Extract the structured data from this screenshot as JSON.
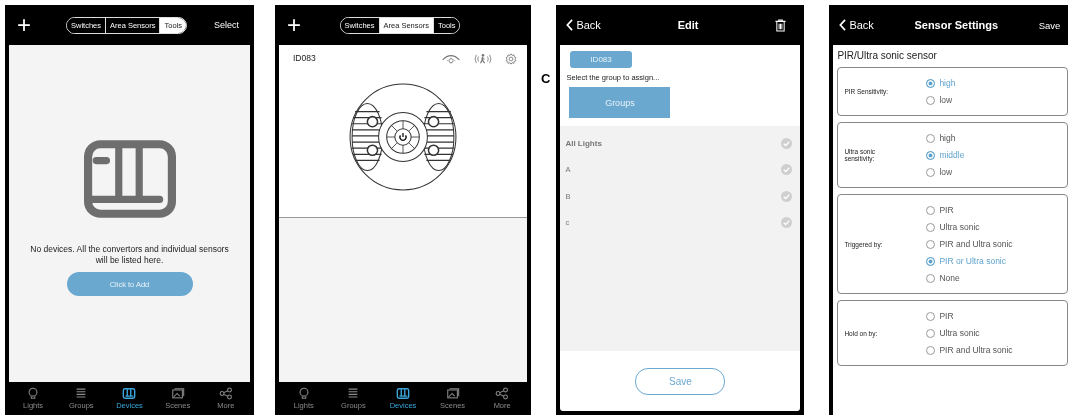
{
  "device_list_screen": {
    "add_button": "+",
    "segments": [
      {
        "label": "Switches",
        "selected": false
      },
      {
        "label": "Area Sensors",
        "selected": false
      },
      {
        "label": "Tools",
        "selected": true
      }
    ],
    "select_button": "Select",
    "empty_message": "No devices. All the convertors and individual sensors will be listed here.",
    "add_device_button": "Click to Add",
    "tab_bar": [
      {
        "label": "Lights",
        "selected": false
      },
      {
        "label": "Groups",
        "selected": false
      },
      {
        "label": "Devices",
        "selected": true
      },
      {
        "label": "Scenes",
        "selected": false
      },
      {
        "label": "More",
        "selected": false
      }
    ]
  },
  "area_sensors_screen": {
    "add_button": "+",
    "segments": [
      {
        "label": "Switches",
        "selected": false
      },
      {
        "label": "Area Sensors",
        "selected": true
      },
      {
        "label": "Tools",
        "selected": false
      }
    ],
    "device_id": "ID083",
    "tab_bar": [
      {
        "label": "Lights",
        "selected": false
      },
      {
        "label": "Groups",
        "selected": false
      },
      {
        "label": "Devices",
        "selected": true
      },
      {
        "label": "Scenes",
        "selected": false
      },
      {
        "label": "More",
        "selected": false
      }
    ]
  },
  "panel_label": "C",
  "edit_screen": {
    "back": "Back",
    "title": "Edit",
    "device_id": "ID083",
    "instruction": "Select the group to assign...",
    "groups_button": "Groups",
    "groups": [
      {
        "name": "All Lights",
        "selected": false
      },
      {
        "name": "A",
        "selected": false
      },
      {
        "name": "B",
        "selected": false
      },
      {
        "name": "c",
        "selected": false
      }
    ],
    "save_button": "Save"
  },
  "sensor_settings_screen": {
    "back": "Back",
    "title": "Sensor Settings",
    "save": "Save",
    "heading": "PIR/Ultra sonic sensor",
    "settings": [
      {
        "label": "PIR Sensitivity:",
        "options": [
          {
            "label": "high",
            "selected": true
          },
          {
            "label": "low",
            "selected": false
          }
        ]
      },
      {
        "label": "Ultra sonic sensitivity:",
        "options": [
          {
            "label": "high",
            "selected": false
          },
          {
            "label": "middle",
            "selected": true
          },
          {
            "label": "low",
            "selected": false
          }
        ]
      },
      {
        "label": "Triggered by:",
        "options": [
          {
            "label": "PIR",
            "selected": false
          },
          {
            "label": "Ultra sonic",
            "selected": false
          },
          {
            "label": "PIR and Ultra sonic",
            "selected": false
          },
          {
            "label": "PIR or Ultra sonic",
            "selected": true
          },
          {
            "label": "None",
            "selected": false
          }
        ]
      },
      {
        "label": "Hold on by:",
        "options": [
          {
            "label": "PIR",
            "selected": false
          },
          {
            "label": "Ultra sonic",
            "selected": false
          },
          {
            "label": "PIR and Ultra sonic",
            "selected": false
          }
        ]
      }
    ]
  }
}
